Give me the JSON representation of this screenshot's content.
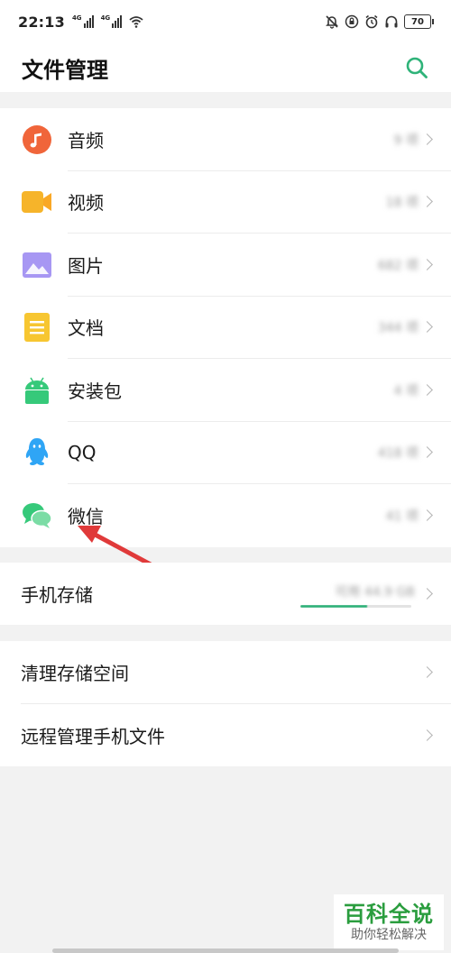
{
  "status_bar": {
    "time": "22:13",
    "signal_tags": [
      "4G",
      "4G"
    ],
    "icons": [
      "bell-off-icon",
      "lock-rotation-icon",
      "alarm-icon",
      "headphones-icon"
    ],
    "battery": "70"
  },
  "header": {
    "title": "文件管理",
    "search_icon": "search-icon",
    "accent_color": "#2fb379"
  },
  "categories": [
    {
      "label": "音频",
      "count": "9 项",
      "icon": "music-note-icon",
      "color": "#f0653a"
    },
    {
      "label": "视频",
      "count": "18 项",
      "icon": "video-camera-icon",
      "color": "#f6b42a"
    },
    {
      "label": "图片",
      "count": "682 项",
      "icon": "image-icon",
      "color": "#9c8cf0"
    },
    {
      "label": "文档",
      "count": "344 项",
      "icon": "document-icon",
      "color": "#f7c631"
    },
    {
      "label": "安装包",
      "count": "4 项",
      "icon": "android-icon",
      "color": "#36c97a"
    },
    {
      "label": "QQ",
      "count": "418 项",
      "icon": "qq-penguin-icon",
      "color": "#2fa5f5"
    },
    {
      "label": "微信",
      "count": "41 项",
      "icon": "wechat-icon",
      "color": "#36c97a"
    }
  ],
  "storage": {
    "label": "手机存储",
    "available": "可用 44.9 GB",
    "used_fraction": 0.6
  },
  "tools": [
    {
      "label": "清理存储空间"
    },
    {
      "label": "远程管理手机文件"
    }
  ],
  "annotation": {
    "color": "#e03a3a"
  },
  "watermark": {
    "main": "百科全说",
    "sub": "助你轻松解决"
  }
}
